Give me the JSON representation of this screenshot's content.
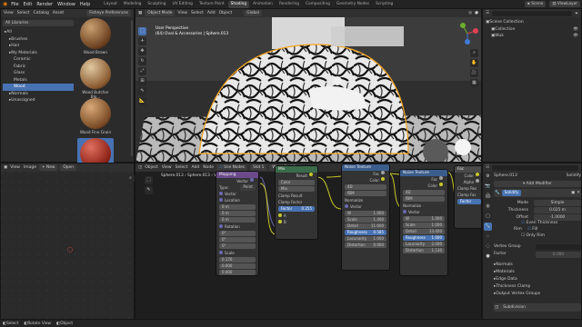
{
  "menu": [
    "File",
    "Edit",
    "Render",
    "Window",
    "Help"
  ],
  "workspaces": [
    "Layout",
    "Modeling",
    "Sculpting",
    "UV Editing",
    "Texture Paint",
    "Shading",
    "Animation",
    "Rendering",
    "Compositing",
    "Geometry Nodes",
    "Scripting"
  ],
  "active_workspace": "Shading",
  "scene": {
    "label": "Scene",
    "view_layer": "ViewLayer"
  },
  "filebrowser": {
    "header": [
      "View",
      "Select",
      "Catalog",
      "Asset"
    ],
    "folder": "Fisheye Preferences",
    "library": "All Libraries",
    "tree": [
      {
        "label": "All",
        "indent": 0
      },
      {
        "label": "Brushes",
        "indent": 1
      },
      {
        "label": "Hair",
        "indent": 1
      },
      {
        "label": "My Materials",
        "indent": 1
      },
      {
        "label": "Ceramic",
        "indent": 2
      },
      {
        "label": "Fabric",
        "indent": 2
      },
      {
        "label": "Glass",
        "indent": 2
      },
      {
        "label": "Metals",
        "indent": 2
      },
      {
        "label": "Wood",
        "indent": 2,
        "selected": true
      },
      {
        "label": "Normals",
        "indent": 1
      },
      {
        "label": "Unassigned",
        "indent": 1
      }
    ],
    "assets": [
      {
        "label": "Wood Brown",
        "c1": "#c8a070",
        "c2": "#6b4020"
      },
      {
        "label": "Wood Butcher Blo...",
        "c1": "#e0c8a0",
        "c2": "#8a5a30"
      },
      {
        "label": "Wood Fine Grain",
        "c1": "#d8a878",
        "c2": "#7a4a25"
      },
      {
        "label": "Wood Red",
        "c1": "#e07060",
        "c2": "#8a2015",
        "selected": true
      }
    ]
  },
  "viewport": {
    "mode": "Object Mode",
    "menus": [
      "View",
      "Select",
      "Add",
      "Object"
    ],
    "orientation": "Global",
    "info_line1": "User Perspective",
    "info_line2": "(64) Oval & Accessories | Sphere.013"
  },
  "outliner": {
    "title": "Scene Collection",
    "items": [
      {
        "label": "Scene Collection",
        "indent": 0
      },
      {
        "label": "Collection",
        "indent": 1
      },
      {
        "label": "Wuk",
        "indent": 1
      }
    ]
  },
  "image_editor": {
    "menus": [
      "View",
      "Image"
    ],
    "new_label": "New",
    "open_label": "Open"
  },
  "node_editor": {
    "menus": [
      "Object",
      "View",
      "Select",
      "Add",
      "Node"
    ],
    "use_nodes": "Use Nodes",
    "slot": "Slot 1",
    "material": "Wood Red 3",
    "breadcrumb": [
      "Sphere.013",
      "Sphere.013",
      "Wood Red 3"
    ]
  },
  "nodes": {
    "mapping": {
      "title": "Mapping",
      "vector_out": "Vector",
      "type_label": "Type:",
      "type_value": "Point",
      "vector_in": "Vector",
      "location": "Location",
      "loc": [
        "0 m",
        "0 m",
        "0 m"
      ],
      "rotation": "Rotation",
      "rot": [
        "0°",
        "0°",
        "0°"
      ],
      "scale": "Scale",
      "scl": [
        "0.170",
        "0.000",
        "0.000"
      ]
    },
    "mix": {
      "title": "Mix",
      "result": "Result",
      "data_type": "Color",
      "blend": "Mix",
      "clamp_result": "Clamp Result",
      "clamp_factor": "Clamp Factor",
      "factor_label": "Factor",
      "factor_value": "0.255",
      "a": "A",
      "b": "B"
    },
    "noise": {
      "title": "Noise Texture",
      "fac": "Fac",
      "color": "Color",
      "dims": "4D",
      "type": "fBM",
      "normalize": "Normalize",
      "vector": "Vector",
      "fields": [
        {
          "label": "W",
          "value": "1.000"
        },
        {
          "label": "Scale",
          "value": "1.400"
        },
        {
          "label": "Detail",
          "value": "11.600"
        },
        {
          "label": "Roughness",
          "value": "0.585",
          "blue": true
        },
        {
          "label": "Lacunarity",
          "value": "1.000"
        },
        {
          "label": "Distortion",
          "value": "0.000"
        }
      ]
    },
    "noise2": {
      "title": "Noise Texture",
      "fac": "Fac",
      "color": "Color",
      "dims": "4D",
      "type": "fBM",
      "normalize": "Normalize",
      "vector": "Vector",
      "fields": [
        {
          "label": "W",
          "value": "1.000"
        },
        {
          "label": "Scale",
          "value": "1.000"
        },
        {
          "label": "Detail",
          "value": "13.400"
        },
        {
          "label": "Roughness",
          "value": "1.000",
          "blue": true
        },
        {
          "label": "Lacunarity",
          "value": "2.000"
        },
        {
          "label": "Distortion",
          "value": "1.130"
        }
      ]
    },
    "ramp": {
      "title": "Fac",
      "color": "Color",
      "alpha": "Alpha",
      "clamp": "Clamp Res",
      "clampf": "Clamp Fac",
      "factor": "Factor"
    }
  },
  "properties": {
    "object": "Sphere.013",
    "modifier_tab": "Solidify",
    "add_modifier": "Add Modifier",
    "mod_name": "Solidify",
    "fields": [
      {
        "label": "Mode",
        "value": "Simple"
      },
      {
        "label": "Thickness",
        "value": "0.025 m"
      },
      {
        "label": "Offset",
        "value": "-1.0000"
      }
    ],
    "even_thickness": "Even Thickness",
    "rim": "Rim",
    "fill": "Fill",
    "only_rim": "Only Rim",
    "vertex_group": "Vertex Group",
    "factor": "Factor",
    "factor_value": "0.000",
    "sections": [
      "Normals",
      "Materials",
      "Edge Data",
      "Thickness Clamp",
      "Output Vertex Groups"
    ],
    "subdivision": "Subdivision"
  },
  "status": [
    "Select",
    "Rotate View",
    "Object"
  ],
  "colors": {
    "accent": "#4772b3",
    "selection": "#f5a623",
    "node_purple": "#6a4a8a",
    "node_blue": "#3b5d8c",
    "node_green": "#3a6b4a"
  }
}
